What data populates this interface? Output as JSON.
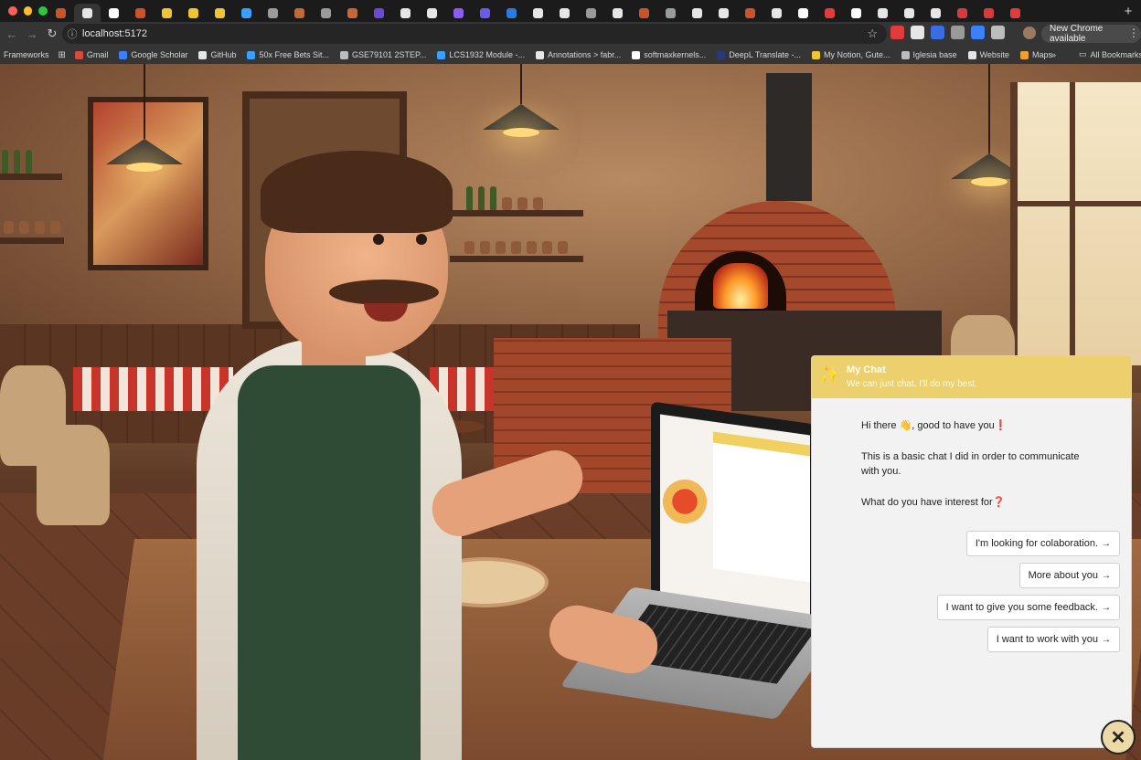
{
  "browser": {
    "tab_colors": [
      "#c9532b",
      "#e6e6e6",
      "#ffffff",
      "#c9532b",
      "#f0c530",
      "#f0c530",
      "#f0c530",
      "#3aa0ff",
      "#9b9b9b",
      "#c06a3a",
      "#9b9b9b",
      "#c06a3a",
      "#6a4bd8",
      "#e6e6e6",
      "#e6e6e6",
      "#8a5cf5",
      "#6a5af0",
      "#2a7be0",
      "#e6e6e6",
      "#e6e6e6",
      "#9b9b9b",
      "#e6e6e6",
      "#c9532b",
      "#9b9b9b",
      "#e6e6e6",
      "#e6e6e6",
      "#c9532b",
      "#e6e6e6",
      "#ffffff",
      "#e33b3b",
      "#ffffff",
      "#e6e6e6",
      "#e6e6e6",
      "#e6e6e6",
      "#d63a3a",
      "#d63a3a",
      "#e33b3b"
    ],
    "active_tab_index": 1,
    "new_tab_symbol": "+",
    "url": "localhost:5172",
    "update_label": "New Chrome available",
    "extension_colors": [
      "#e23b3b",
      "#e6e6e6",
      "#3b6de2",
      "#9a9a9a",
      "#3b80ff",
      "#bdbdbd"
    ],
    "nav": {
      "back": "←",
      "forward": "→",
      "reload": "↻",
      "star": "☆",
      "kebab": "⋮",
      "info": "ⓘ"
    }
  },
  "bookmarks": {
    "apps_label": "Frameworks",
    "items": [
      {
        "label": "Gmail",
        "color": "#d84b3a"
      },
      {
        "label": "Google Scholar",
        "color": "#3b80ff"
      },
      {
        "label": "GitHub",
        "color": "#e6e6e6"
      },
      {
        "label": "50x Free Bets Sit...",
        "color": "#3aa0ff"
      },
      {
        "label": "GSE79101 2STEP...",
        "color": "#bdbdbd"
      },
      {
        "label": "LCS1932 Module -...",
        "color": "#3aa0ff"
      },
      {
        "label": "Annotations > fabr...",
        "color": "#e6e6e6"
      },
      {
        "label": "softmaxkernels...",
        "color": "#ffffff"
      },
      {
        "label": "DeepL Translate -...",
        "color": "#2a3a7a"
      },
      {
        "label": "My Notion, Gute...",
        "color": "#f0c530"
      },
      {
        "label": "Iglesia base",
        "color": "#bdbdbd"
      },
      {
        "label": "Website",
        "color": "#e6e6e6"
      },
      {
        "label": "Maps",
        "color": "#f0a030"
      }
    ],
    "more": "»",
    "all_label": "All Bookmarks"
  },
  "chat": {
    "title": "My Chat",
    "subtitle": "We can just chat, I'll do my best.",
    "icon": "sparkle-icon",
    "messages": [
      "Hi there 👋, good to have you❗",
      "This is a basic chat I did in order to communicate with you.",
      "What do you have interest for❓"
    ],
    "options": [
      {
        "label": "I'm looking for colaboration.",
        "arrow": "→"
      },
      {
        "label": "More about you",
        "arrow": "→"
      },
      {
        "label": "I want to give you some feedback.",
        "arrow": "→"
      },
      {
        "label": "I want to work with you",
        "arrow": "→"
      }
    ],
    "close_symbol": "✕",
    "accent": "#ecd06e"
  }
}
